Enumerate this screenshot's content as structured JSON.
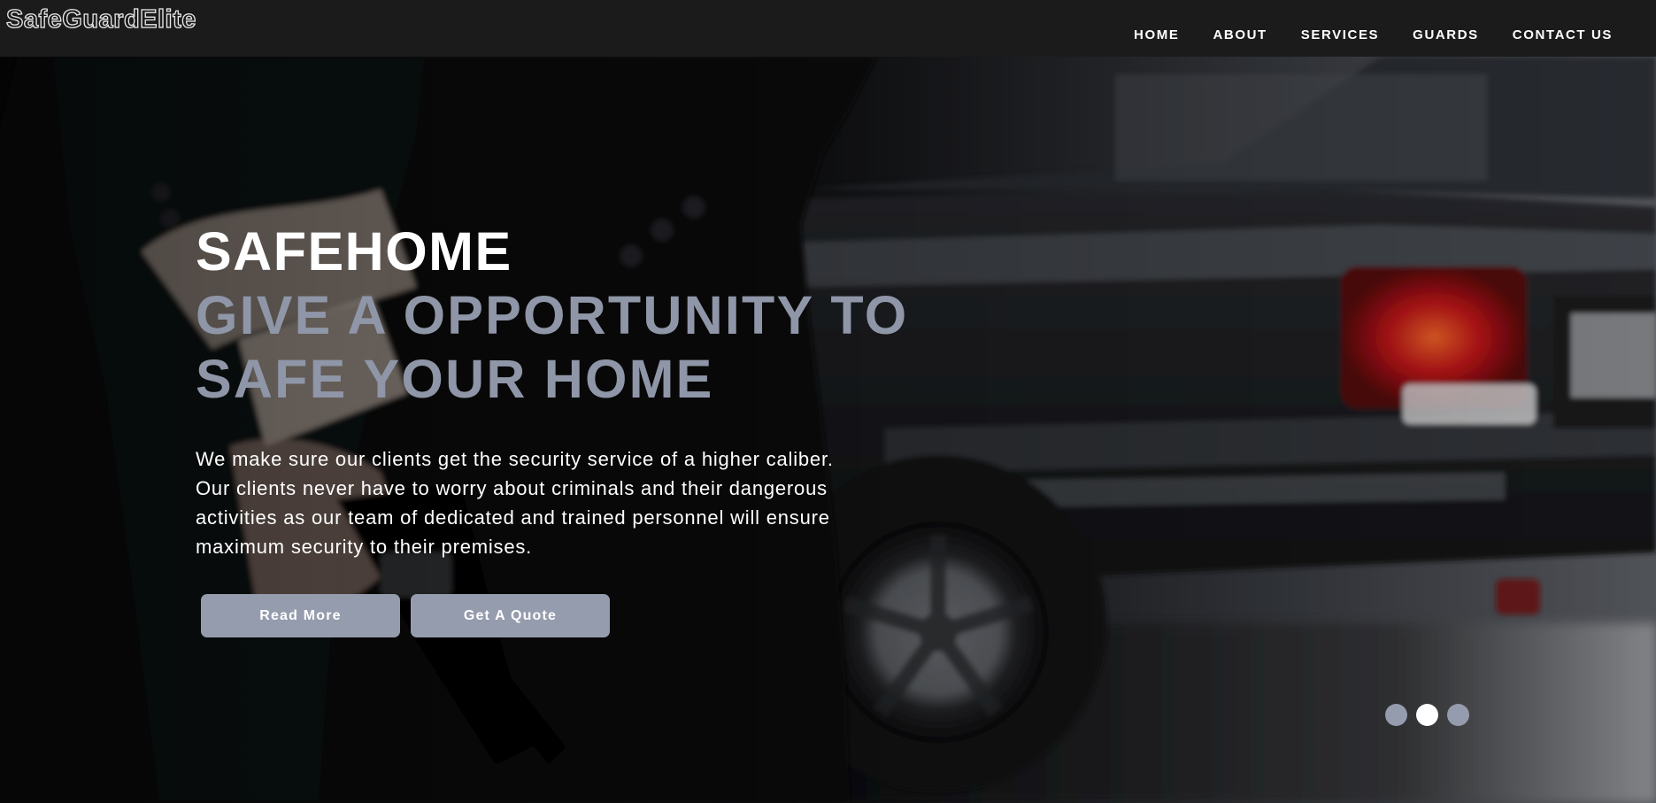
{
  "brand": {
    "name": "SafeGuardElite"
  },
  "nav": {
    "items": [
      {
        "label": "HOME"
      },
      {
        "label": "ABOUT"
      },
      {
        "label": "SERVICES"
      },
      {
        "label": "GUARDS"
      },
      {
        "label": "CONTACT US"
      }
    ]
  },
  "hero": {
    "eyebrow": "SAFEHOME",
    "headline_line1": "GIVE A OPPORTUNITY TO",
    "headline_line2": "SAFE YOUR HOME",
    "intro_line1": "We make sure our clients get the security service of a higher caliber.",
    "intro_line2": "Our clients never have to worry about criminals and their dangerous",
    "intro_line3": "activities as our team of dedicated and trained personnel will ensure",
    "intro_line4": "maximum security to their premises.",
    "buttons": {
      "read_more": "Read More",
      "get_quote": "Get A Quote"
    },
    "slider": {
      "slide_count": 3,
      "active_slide": 2
    }
  },
  "colors": {
    "navbar_bg": "#1b1b1b",
    "accent": "#959cad",
    "headline": "#8f96a8",
    "text": "#ffffff"
  }
}
